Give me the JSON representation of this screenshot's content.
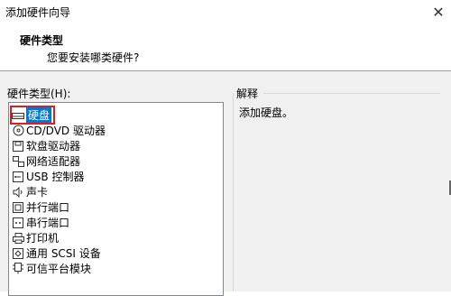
{
  "window": {
    "title": "添加硬件向导",
    "close_glyph": "✕"
  },
  "header": {
    "title": "硬件类型",
    "subtitle": "您要安装哪类硬件?"
  },
  "hardware_list": {
    "label": "硬件类型(H):",
    "items": [
      {
        "label": "硬盘",
        "icon": "hard-disk-icon",
        "selected": true
      },
      {
        "label": "CD/DVD 驱动器",
        "icon": "cd-dvd-icon",
        "selected": false
      },
      {
        "label": "软盘驱动器",
        "icon": "floppy-icon",
        "selected": false
      },
      {
        "label": "网络适配器",
        "icon": "network-adapter-icon",
        "selected": false
      },
      {
        "label": "USB 控制器",
        "icon": "usb-icon",
        "selected": false
      },
      {
        "label": "声卡",
        "icon": "sound-icon",
        "selected": false
      },
      {
        "label": "并行端口",
        "icon": "parallel-port-icon",
        "selected": false
      },
      {
        "label": "串行端口",
        "icon": "serial-port-icon",
        "selected": false
      },
      {
        "label": "打印机",
        "icon": "printer-icon",
        "selected": false
      },
      {
        "label": "通用 SCSI 设备",
        "icon": "scsi-icon",
        "selected": false
      },
      {
        "label": "可信平台模块",
        "icon": "tpm-icon",
        "selected": false
      }
    ]
  },
  "explanation": {
    "label": "解释",
    "text": "添加硬盘。"
  },
  "colors": {
    "selection": "#0078d7",
    "highlight_border": "#e11e1e"
  }
}
